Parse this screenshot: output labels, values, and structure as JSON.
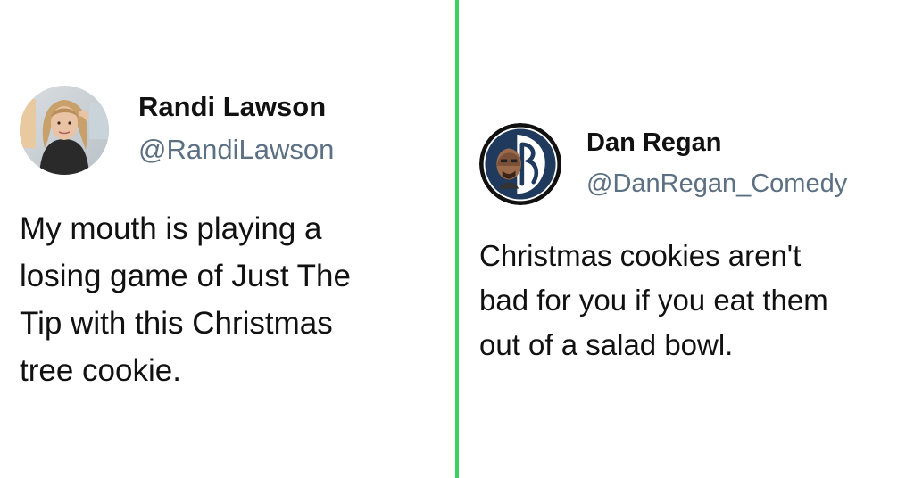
{
  "layout": {
    "divider_color": "#3ecf63"
  },
  "tweets": [
    {
      "name": "Randi Lawson",
      "handle": "@RandiLawson",
      "avatar_icon": "profile-photo-icon",
      "text": "My mouth is playing a\nlosing game of Just The\nTip with this Christmas\ntree cookie."
    },
    {
      "name": "Dan Regan",
      "handle": "@DanRegan_Comedy",
      "avatar_icon": "dr-logo-avatar-icon",
      "text": "Christmas cookies aren't\nbad for you if you eat them\nout of a salad bowl."
    }
  ]
}
